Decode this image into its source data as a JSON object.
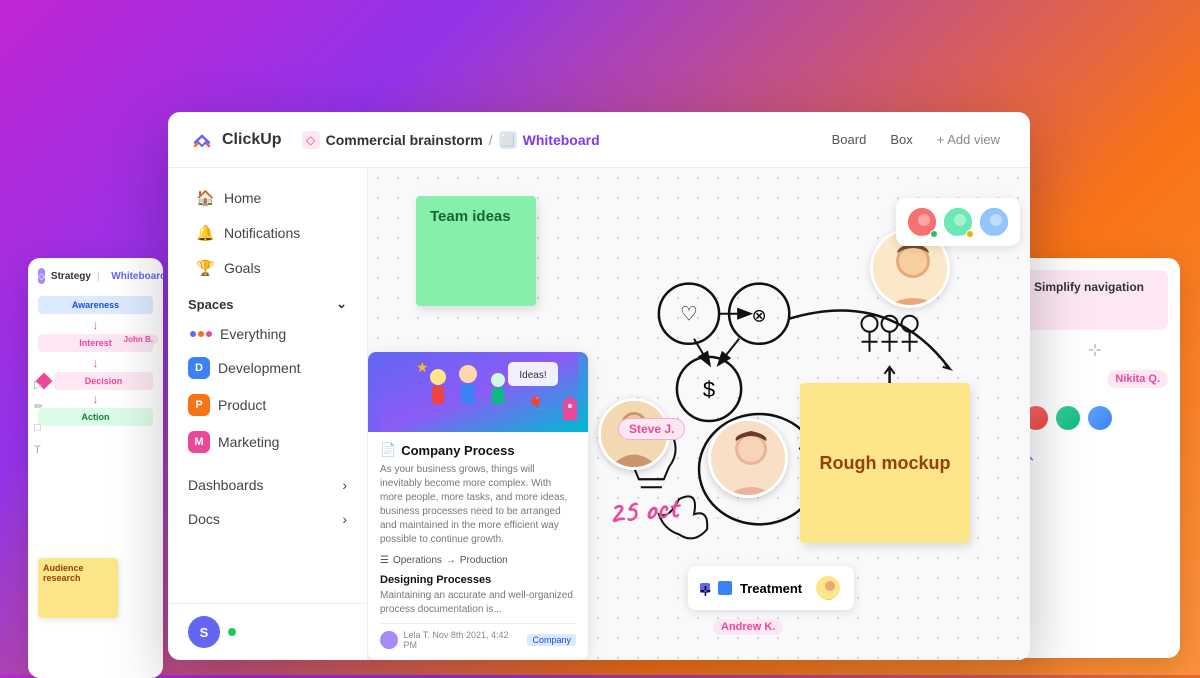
{
  "app": {
    "name": "ClickUp"
  },
  "header": {
    "breadcrumb_space": "Commercial brainstorm",
    "active_view": "Whiteboard",
    "views": [
      "Board",
      "Box"
    ],
    "add_view_label": "+ Add view"
  },
  "sidebar": {
    "nav_items": [
      {
        "label": "Home",
        "icon": "🏠"
      },
      {
        "label": "Notifications",
        "icon": "🔔"
      },
      {
        "label": "Goals",
        "icon": "🎯"
      }
    ],
    "spaces_label": "Spaces",
    "spaces": [
      {
        "label": "Everything",
        "icon": "⋯",
        "type": "all"
      },
      {
        "label": "Development",
        "badge": "D",
        "badge_class": "dev"
      },
      {
        "label": "Product",
        "badge": "P",
        "badge_class": "prod"
      },
      {
        "label": "Marketing",
        "badge": "M",
        "badge_class": "mkt"
      }
    ],
    "bottom_items": [
      {
        "label": "Dashboards"
      },
      {
        "label": "Docs"
      }
    ],
    "user_initial": "S"
  },
  "whiteboard": {
    "sticky_green_text": "Team ideas",
    "sticky_yellow_text": "Rough mockup",
    "date_text": "25 oct",
    "tag_steve": "Steve J.",
    "tag_nikita": "Nikita Q.",
    "tag_andrew": "Andrew K.",
    "treatment_label": "Treatment",
    "card": {
      "title": "Company Process",
      "body_text": "As your business grows, things will inevitably become more complex. With more people, more tasks, and more ideas, business processes need to be arranged and maintained in the more efficient way possible to continue growth.",
      "flow_from": "Operations",
      "flow_to": "Production",
      "sub_title": "Designing Processes",
      "sub_text": "Maintaining an accurate and well-organized process documentation is...",
      "footer_author": "Lela T.",
      "footer_date": "Nov 8th 2021, 4:42 PM",
      "footer_tag": "Company"
    }
  },
  "bg_left": {
    "tab_label": "Strategy",
    "tab2_label": "Whiteboard",
    "nodes": [
      "Awareness",
      "Interest",
      "Decision",
      "Action"
    ],
    "audience_label": "Audience research",
    "john_label": "John B."
  },
  "bg_right": {
    "simplify_label": "Simplify navigation",
    "nikita_label": "Nikita Q."
  }
}
